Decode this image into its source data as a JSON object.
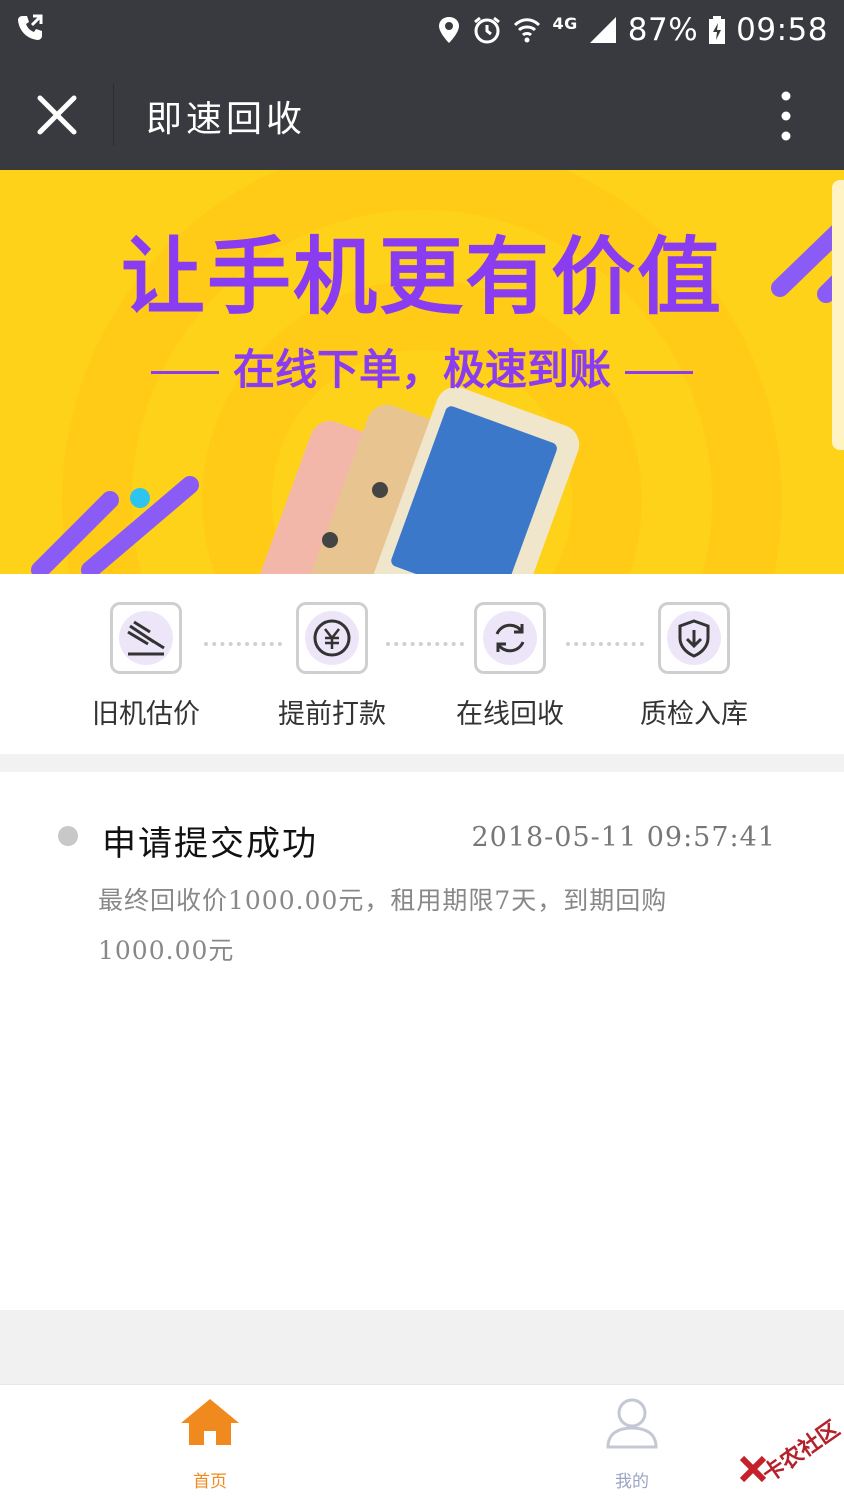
{
  "status_bar": {
    "battery": "87%",
    "time": "09:58",
    "network": "4G",
    "icons": [
      "call-forward-icon",
      "location-icon",
      "alarm-icon",
      "wifi-icon",
      "signal-icon",
      "battery-charging-icon"
    ]
  },
  "title_bar": {
    "title": "即速回收",
    "close_icon": "close-icon",
    "more_icon": "more-vertical-icon"
  },
  "banner": {
    "headline": "让手机更有价值",
    "subline": "在线下单，极速到账"
  },
  "steps": [
    {
      "label": "旧机估价",
      "icon": "gavel-icon"
    },
    {
      "label": "提前打款",
      "icon": "yuan-coin-icon"
    },
    {
      "label": "在线回收",
      "icon": "refresh-icon"
    },
    {
      "label": "质检入库",
      "icon": "shield-download-icon"
    }
  ],
  "record": {
    "title": "申请提交成功",
    "time": "2018-05-11 09:57:41",
    "description": "最终回收价1000.00元，租用期限7天，到期回购1000.00元"
  },
  "tabs": [
    {
      "label": "首页",
      "icon": "home-icon",
      "active": true
    },
    {
      "label": "我的",
      "icon": "user-icon",
      "active": false
    }
  ],
  "watermark": "卡农社区",
  "colors": {
    "header_bg": "#393a3f",
    "banner_bg": "#ffd21a",
    "banner_text": "#8a3cf0",
    "tab_active": "#f08a1e",
    "tab_inactive": "#9aa5c4"
  }
}
